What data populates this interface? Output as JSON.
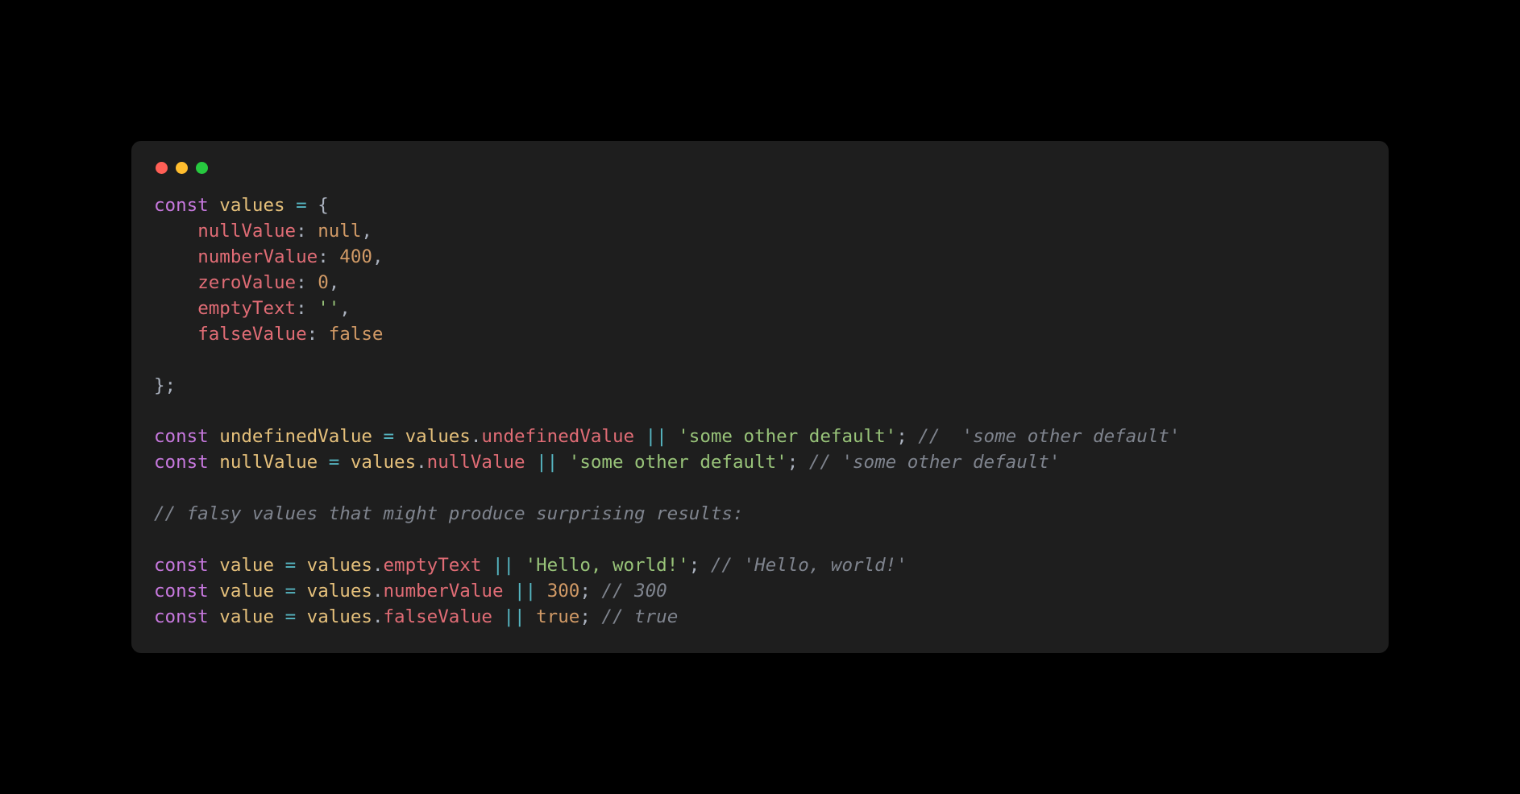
{
  "code": {
    "tokens": [
      {
        "cls": "tok-kw",
        "t": "const"
      },
      {
        "cls": "",
        "t": " "
      },
      {
        "cls": "tok-var",
        "t": "values"
      },
      {
        "cls": "",
        "t": " "
      },
      {
        "cls": "tok-op",
        "t": "="
      },
      {
        "cls": "",
        "t": " "
      },
      {
        "cls": "tok-punc",
        "t": "{"
      },
      {
        "cls": "",
        "t": "\n    "
      },
      {
        "cls": "tok-obj",
        "t": "nullValue"
      },
      {
        "cls": "tok-punc",
        "t": ":"
      },
      {
        "cls": "",
        "t": " "
      },
      {
        "cls": "tok-bool",
        "t": "null"
      },
      {
        "cls": "tok-punc",
        "t": ","
      },
      {
        "cls": "",
        "t": "\n    "
      },
      {
        "cls": "tok-obj",
        "t": "numberValue"
      },
      {
        "cls": "tok-punc",
        "t": ":"
      },
      {
        "cls": "",
        "t": " "
      },
      {
        "cls": "tok-num",
        "t": "400"
      },
      {
        "cls": "tok-punc",
        "t": ","
      },
      {
        "cls": "",
        "t": "\n    "
      },
      {
        "cls": "tok-obj",
        "t": "zeroValue"
      },
      {
        "cls": "tok-punc",
        "t": ":"
      },
      {
        "cls": "",
        "t": " "
      },
      {
        "cls": "tok-num",
        "t": "0"
      },
      {
        "cls": "tok-punc",
        "t": ","
      },
      {
        "cls": "",
        "t": "\n    "
      },
      {
        "cls": "tok-obj",
        "t": "emptyText"
      },
      {
        "cls": "tok-punc",
        "t": ":"
      },
      {
        "cls": "",
        "t": " "
      },
      {
        "cls": "tok-str",
        "t": "''"
      },
      {
        "cls": "tok-punc",
        "t": ","
      },
      {
        "cls": "",
        "t": "\n    "
      },
      {
        "cls": "tok-obj",
        "t": "falseValue"
      },
      {
        "cls": "tok-punc",
        "t": ":"
      },
      {
        "cls": "",
        "t": " "
      },
      {
        "cls": "tok-bool",
        "t": "false"
      },
      {
        "cls": "",
        "t": "\n\n"
      },
      {
        "cls": "tok-punc",
        "t": "};"
      },
      {
        "cls": "",
        "t": "\n\n"
      },
      {
        "cls": "tok-kw",
        "t": "const"
      },
      {
        "cls": "",
        "t": " "
      },
      {
        "cls": "tok-var",
        "t": "undefinedValue"
      },
      {
        "cls": "",
        "t": " "
      },
      {
        "cls": "tok-op",
        "t": "="
      },
      {
        "cls": "",
        "t": " "
      },
      {
        "cls": "tok-var",
        "t": "values"
      },
      {
        "cls": "tok-punc",
        "t": "."
      },
      {
        "cls": "tok-prop",
        "t": "undefinedValue"
      },
      {
        "cls": "",
        "t": " "
      },
      {
        "cls": "tok-op",
        "t": "||"
      },
      {
        "cls": "",
        "t": " "
      },
      {
        "cls": "tok-str",
        "t": "'some other default'"
      },
      {
        "cls": "tok-punc",
        "t": ";"
      },
      {
        "cls": "",
        "t": " "
      },
      {
        "cls": "tok-cmt",
        "t": "//  'some other default'"
      },
      {
        "cls": "",
        "t": "\n"
      },
      {
        "cls": "tok-kw",
        "t": "const"
      },
      {
        "cls": "",
        "t": " "
      },
      {
        "cls": "tok-var",
        "t": "nullValue"
      },
      {
        "cls": "",
        "t": " "
      },
      {
        "cls": "tok-op",
        "t": "="
      },
      {
        "cls": "",
        "t": " "
      },
      {
        "cls": "tok-var",
        "t": "values"
      },
      {
        "cls": "tok-punc",
        "t": "."
      },
      {
        "cls": "tok-prop",
        "t": "nullValue"
      },
      {
        "cls": "",
        "t": " "
      },
      {
        "cls": "tok-op",
        "t": "||"
      },
      {
        "cls": "",
        "t": " "
      },
      {
        "cls": "tok-str",
        "t": "'some other default'"
      },
      {
        "cls": "tok-punc",
        "t": ";"
      },
      {
        "cls": "",
        "t": " "
      },
      {
        "cls": "tok-cmt",
        "t": "// 'some other default'"
      },
      {
        "cls": "",
        "t": "\n\n"
      },
      {
        "cls": "tok-cmt",
        "t": "// falsy values that might produce surprising results:"
      },
      {
        "cls": "",
        "t": "\n\n"
      },
      {
        "cls": "tok-kw",
        "t": "const"
      },
      {
        "cls": "",
        "t": " "
      },
      {
        "cls": "tok-var",
        "t": "value"
      },
      {
        "cls": "",
        "t": " "
      },
      {
        "cls": "tok-op",
        "t": "="
      },
      {
        "cls": "",
        "t": " "
      },
      {
        "cls": "tok-var",
        "t": "values"
      },
      {
        "cls": "tok-punc",
        "t": "."
      },
      {
        "cls": "tok-prop",
        "t": "emptyText"
      },
      {
        "cls": "",
        "t": " "
      },
      {
        "cls": "tok-op",
        "t": "||"
      },
      {
        "cls": "",
        "t": " "
      },
      {
        "cls": "tok-str",
        "t": "'Hello, world!'"
      },
      {
        "cls": "tok-punc",
        "t": ";"
      },
      {
        "cls": "",
        "t": " "
      },
      {
        "cls": "tok-cmt",
        "t": "// 'Hello, world!'"
      },
      {
        "cls": "",
        "t": "\n"
      },
      {
        "cls": "tok-kw",
        "t": "const"
      },
      {
        "cls": "",
        "t": " "
      },
      {
        "cls": "tok-var",
        "t": "value"
      },
      {
        "cls": "",
        "t": " "
      },
      {
        "cls": "tok-op",
        "t": "="
      },
      {
        "cls": "",
        "t": " "
      },
      {
        "cls": "tok-var",
        "t": "values"
      },
      {
        "cls": "tok-punc",
        "t": "."
      },
      {
        "cls": "tok-prop",
        "t": "numberValue"
      },
      {
        "cls": "",
        "t": " "
      },
      {
        "cls": "tok-op",
        "t": "||"
      },
      {
        "cls": "",
        "t": " "
      },
      {
        "cls": "tok-num",
        "t": "300"
      },
      {
        "cls": "tok-punc",
        "t": ";"
      },
      {
        "cls": "",
        "t": " "
      },
      {
        "cls": "tok-cmt",
        "t": "// 300"
      },
      {
        "cls": "",
        "t": "\n"
      },
      {
        "cls": "tok-kw",
        "t": "const"
      },
      {
        "cls": "",
        "t": " "
      },
      {
        "cls": "tok-var",
        "t": "value"
      },
      {
        "cls": "",
        "t": " "
      },
      {
        "cls": "tok-op",
        "t": "="
      },
      {
        "cls": "",
        "t": " "
      },
      {
        "cls": "tok-var",
        "t": "values"
      },
      {
        "cls": "tok-punc",
        "t": "."
      },
      {
        "cls": "tok-prop",
        "t": "falseValue"
      },
      {
        "cls": "",
        "t": " "
      },
      {
        "cls": "tok-op",
        "t": "||"
      },
      {
        "cls": "",
        "t": " "
      },
      {
        "cls": "tok-bool",
        "t": "true"
      },
      {
        "cls": "tok-punc",
        "t": ";"
      },
      {
        "cls": "",
        "t": " "
      },
      {
        "cls": "tok-cmt",
        "t": "// true"
      }
    ]
  }
}
